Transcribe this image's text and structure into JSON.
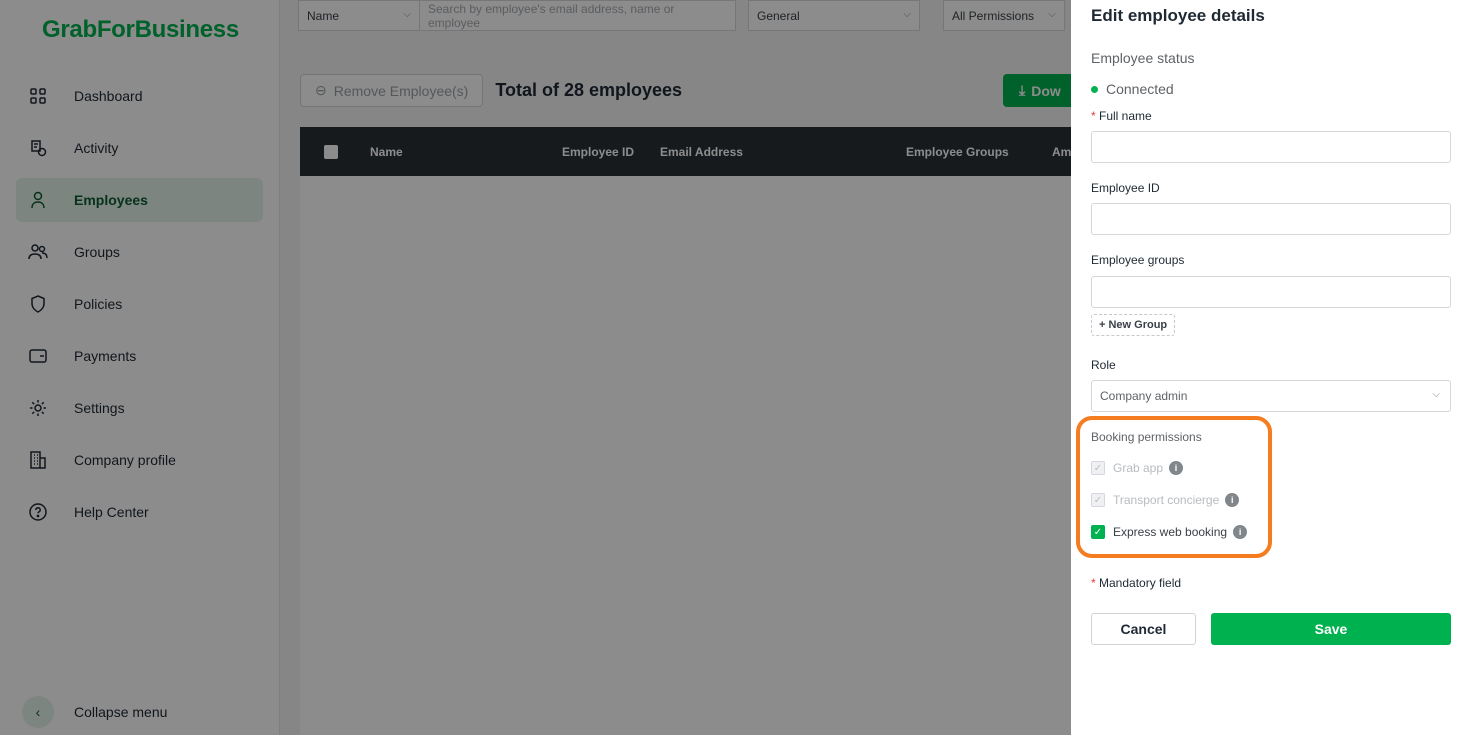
{
  "brand": {
    "logo": "GrabForBusiness",
    "accent": "#00B14F"
  },
  "sidebar": {
    "items": [
      {
        "label": "Dashboard",
        "icon": "dashboard-grid-icon"
      },
      {
        "label": "Activity",
        "icon": "activity-document-icon"
      },
      {
        "label": "Employees",
        "icon": "person-icon",
        "active": true
      },
      {
        "label": "Groups",
        "icon": "group-people-icon"
      },
      {
        "label": "Policies",
        "icon": "shield-icon"
      },
      {
        "label": "Payments",
        "icon": "wallet-icon"
      },
      {
        "label": "Settings",
        "icon": "gear-icon"
      },
      {
        "label": "Company profile",
        "icon": "building-icon"
      },
      {
        "label": "Help Center",
        "icon": "question-circle-icon"
      }
    ],
    "collapse_label": "Collapse menu"
  },
  "main": {
    "filters": {
      "field_select": "Name",
      "search_placeholder": "Search by employee's email address, name or employee",
      "group_select": "General",
      "permission_select": "All Permissions"
    },
    "remove_label": "Remove Employee(s)",
    "total_text": "Total of 28 employees",
    "download_label": "Dow",
    "columns": [
      "Name",
      "Employee ID",
      "Email Address",
      "Employee Groups",
      "Am"
    ]
  },
  "drawer": {
    "title": "Edit employee details",
    "status_label": "Employee status",
    "status_value": "Connected",
    "full_name_label": "Full name",
    "full_name_value": "",
    "employee_id_label": "Employee ID",
    "employee_id_value": "",
    "groups_label": "Employee groups",
    "groups_value": "",
    "new_group_label": "+ New Group",
    "role_label": "Role",
    "role_value": "Company admin",
    "booking_label": "Booking permissions",
    "permissions": [
      {
        "label": "Grab app",
        "checked": true,
        "disabled": true
      },
      {
        "label": "Transport concierge",
        "checked": true,
        "disabled": true
      },
      {
        "label": "Express web booking",
        "checked": true,
        "disabled": false
      }
    ],
    "mandatory_note": "Mandatory field",
    "required_mark": "*",
    "cancel_label": "Cancel",
    "save_label": "Save",
    "highlight_color": "#f57c1f"
  }
}
